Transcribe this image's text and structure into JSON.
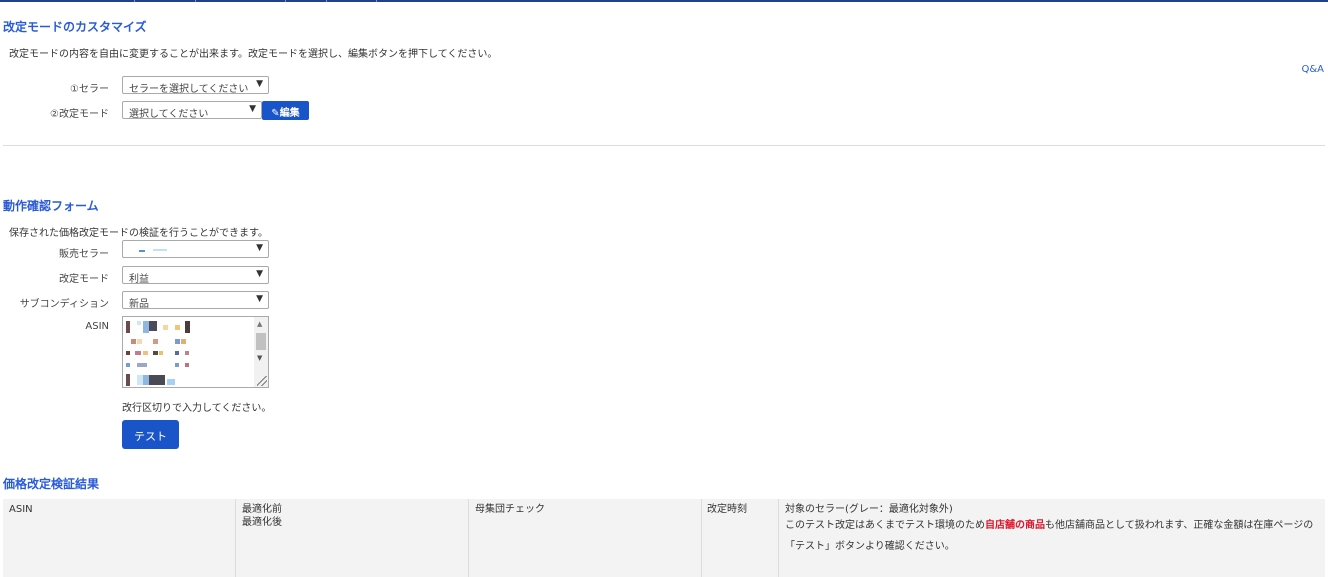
{
  "customize": {
    "title": "改定モードのカスタマイズ",
    "description": "改定モードの内容を自由に変更することが出来ます。改定モードを選択し、編集ボタンを押下してください。",
    "qa_link": "Q&A",
    "seller_label": "①セラー",
    "seller_placeholder": "セラーを選択してください",
    "mode_label": "②改定モード",
    "mode_placeholder": "選択してください",
    "edit_button": "編集"
  },
  "verify_form": {
    "title": "動作確認フォーム",
    "description": "保存された価格改定モードの検証を行うことができます。",
    "seller_label": "販売セラー",
    "mode_label": "改定モード",
    "mode_value": "利益",
    "subcondition_label": "サブコンディション",
    "subcondition_value": "新品",
    "asin_label": "ASIN",
    "asin_hint": "改行区切りで入力してください。",
    "test_button": "テスト"
  },
  "results": {
    "title": "価格改定検証結果",
    "columns": {
      "asin": "ASIN",
      "before": "最適化前",
      "after": "最適化後",
      "population": "母集団チェック",
      "time": "改定時刻",
      "target_seller": "対象のセラー(グレー：最適化対象外)",
      "note_prefix": "このテスト改定はあくまでテスト環境のため",
      "note_highlight": "自店舗の商品",
      "note_suffix": "も他店舗商品として扱われます、正確な金額は在庫ページの",
      "note_line2": "「テスト」ボタンより確認ください。"
    }
  },
  "colors": {
    "accent": "#1955c9",
    "title_blue": "#2a5bd7",
    "highlight_red": "#e0142b"
  }
}
